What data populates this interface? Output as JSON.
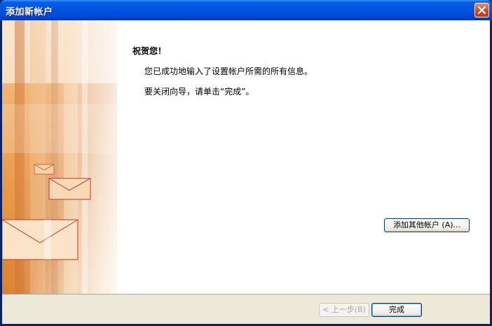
{
  "window": {
    "title": "添加新帐户",
    "close_icon": "close-icon"
  },
  "content": {
    "heading": "祝贺您！",
    "message_1": "您已成功地输入了设置帐户所需的所有信息。",
    "message_2": "要关闭向导，请单击“完成”。"
  },
  "buttons": {
    "add_other_account": "添加其他帐户 (A)...",
    "back": "< 上一步(B)",
    "finish": "完成"
  },
  "colors": {
    "titlebar": "#0052e0",
    "dialog_bg": "#ece9d8",
    "accent_orange": "#e8923a"
  }
}
